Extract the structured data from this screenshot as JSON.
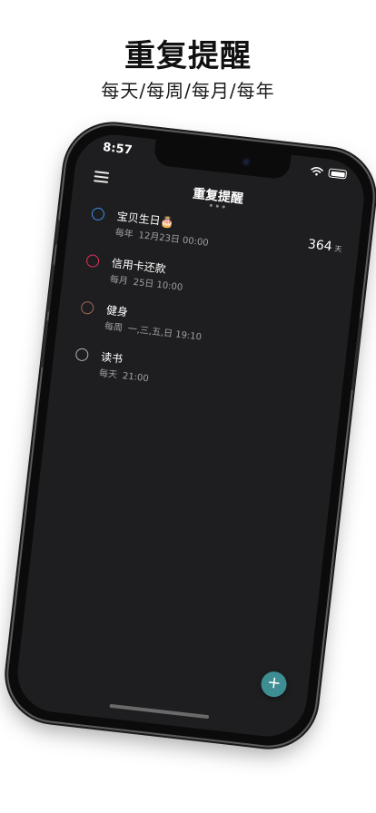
{
  "promo": {
    "title": "重复提醒",
    "subtitle": "每天/每周/每月/每年"
  },
  "status_bar": {
    "time": "8:57"
  },
  "app": {
    "title": "重复提醒",
    "menu_icon": "hamburger-menu-icon",
    "add_label": "+"
  },
  "reminders": [
    {
      "title": "宝贝生日🎂",
      "repeat": "每年",
      "schedule": "12月23日 00:00",
      "circle_color": "#3a8ee6",
      "days": "364",
      "days_unit": "天"
    },
    {
      "title": "信用卡还款",
      "repeat": "每月",
      "schedule": "25日 10:00",
      "circle_color": "#e0315b"
    },
    {
      "title": "健身",
      "repeat": "每周",
      "schedule": "一,三,五,日  19:10",
      "circle_color": "#9a6a55"
    },
    {
      "title": "读书",
      "repeat": "每天",
      "schedule": "21:00",
      "circle_color": "#b0b0b0"
    }
  ],
  "colors": {
    "screen_bg": "#1e1e20",
    "fab": "#3d8d93"
  }
}
